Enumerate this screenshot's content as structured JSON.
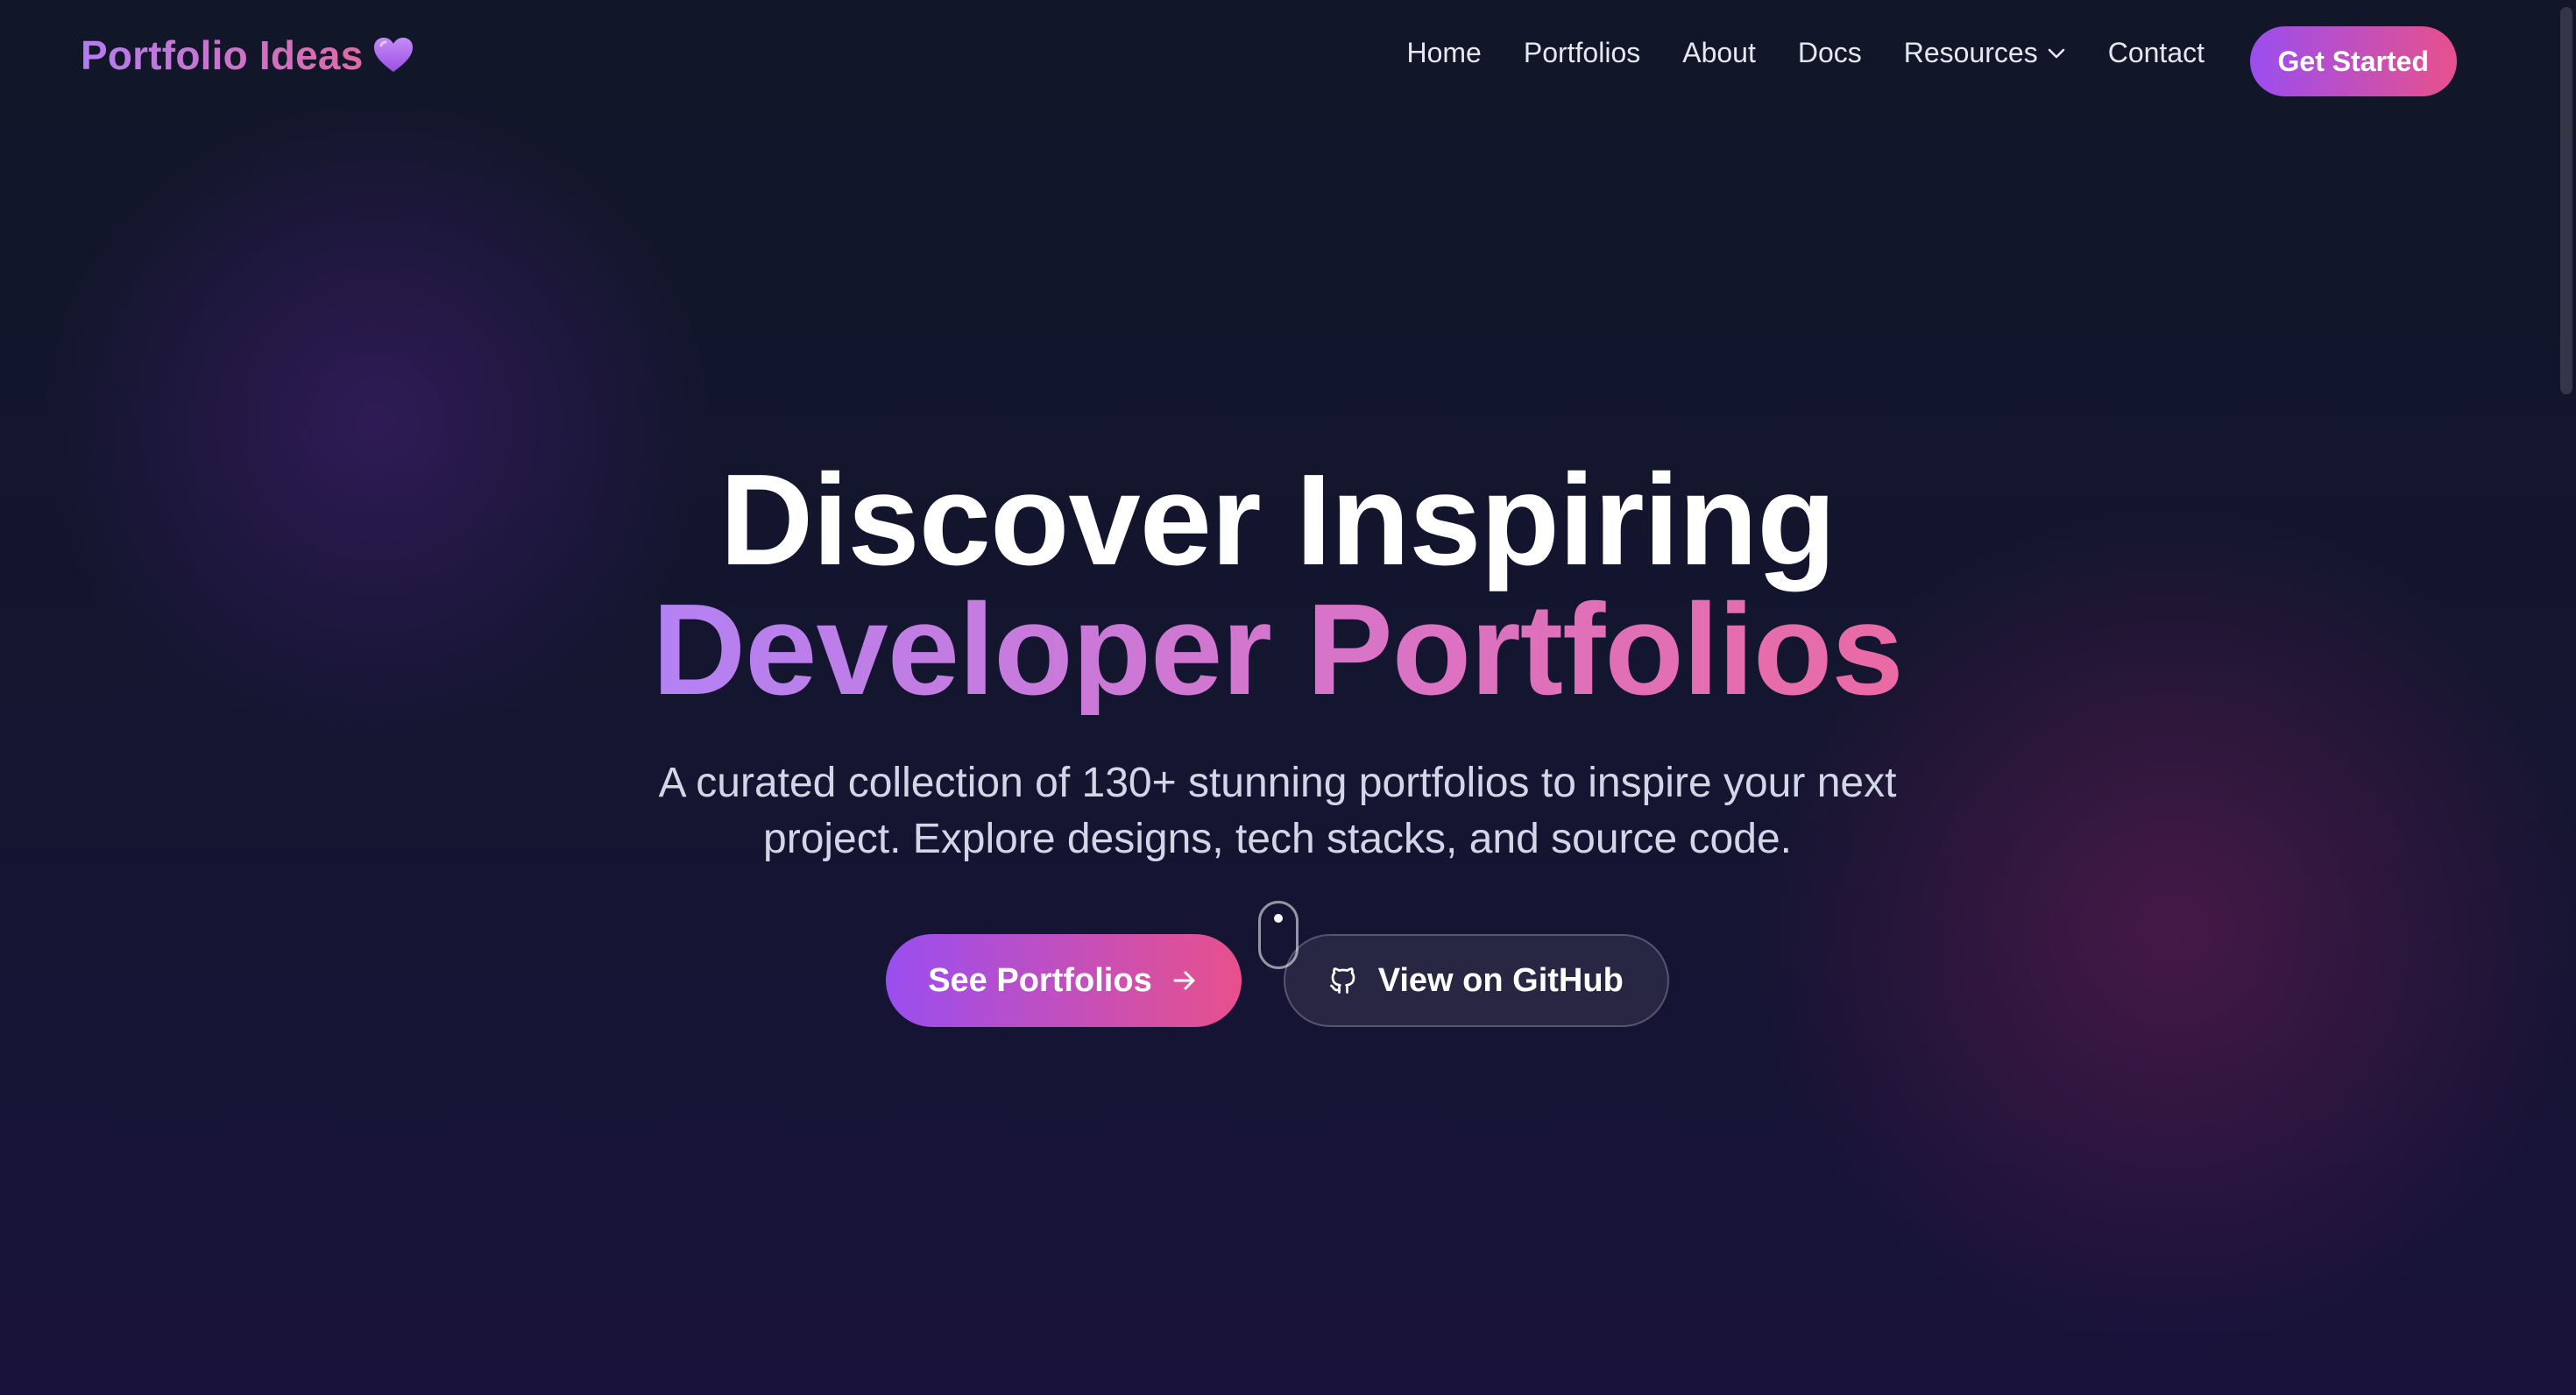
{
  "nav": {
    "brand": "Portfolio Ideas",
    "brand_icon": "purple-heart-icon",
    "links": [
      {
        "label": "Home"
      },
      {
        "label": "Portfolios"
      },
      {
        "label": "About"
      },
      {
        "label": "Docs"
      },
      {
        "label": "Resources",
        "icon": "chevron-down-icon"
      },
      {
        "label": "Contact"
      }
    ],
    "cta_label": "Get Started"
  },
  "hero": {
    "title_line1": "Discover Inspiring",
    "title_line2": "Developer Portfolios",
    "subtitle": "A curated collection of 130+ stunning portfolios to inspire your next project. Explore designs, tech stacks, and source code.",
    "primary_button": {
      "label": "See Portfolios",
      "icon": "arrow-right-icon"
    },
    "secondary_button": {
      "label": "View on GitHub",
      "icon": "github-icon"
    }
  },
  "colors": {
    "background": "#121627",
    "accent_purple": "#9a4ef0",
    "accent_pink": "#e8508c",
    "text_primary": "#ffffff",
    "text_secondary": "#d3d6e6"
  }
}
